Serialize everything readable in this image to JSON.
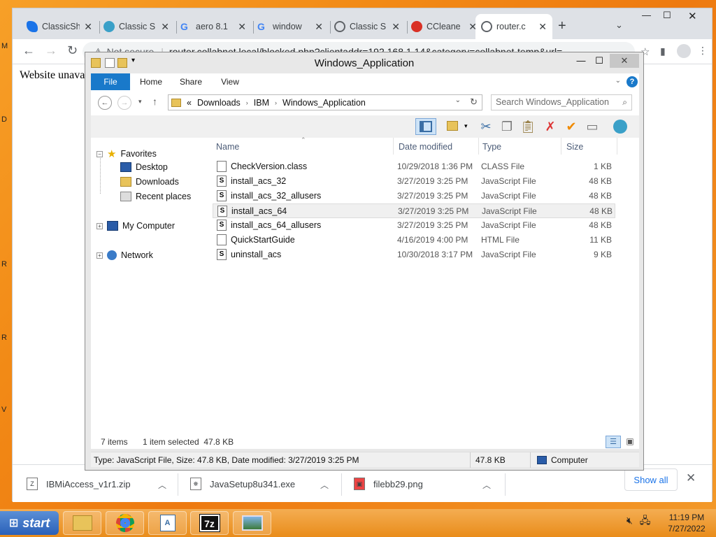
{
  "desktop": {
    "edge_letters": [
      "M",
      "D",
      "R",
      "R",
      "V"
    ]
  },
  "browser": {
    "tabs": [
      {
        "title": "ClassicSh",
        "icon": "classicshell-icon",
        "color": "#1a73e8"
      },
      {
        "title": "Classic S",
        "icon": "classic-shell-shell-icon",
        "color": "#3aa0c8"
      },
      {
        "title": "aero 8.1",
        "icon": "google-icon",
        "color": "#4285f4"
      },
      {
        "title": "window",
        "icon": "google-icon",
        "color": "#4285f4"
      },
      {
        "title": "Classic S",
        "icon": "globe-icon",
        "color": "#5f6368"
      },
      {
        "title": "CCleane",
        "icon": "ccleaner-icon",
        "color": "#d93025"
      },
      {
        "title": "router.c",
        "icon": "globe-icon",
        "color": "#5f6368",
        "active": true
      }
    ],
    "new_tab": "+",
    "omnibox": {
      "security": "Not secure",
      "url": "router.collabnet.local/blocked.php?clientaddr=192.168.1.14&category=collabnet-temp&url="
    },
    "page_text": "Website unavai",
    "downloads": [
      {
        "name": "IBMiAccess_v1r1.zip"
      },
      {
        "name": "JavaSetup8u341.exe"
      },
      {
        "name": "filebb29.png"
      }
    ],
    "show_all": "Show all"
  },
  "explorer": {
    "title": "Windows_Application",
    "ribbon_tabs": {
      "file": "File",
      "home": "Home",
      "share": "Share",
      "view": "View"
    },
    "address": {
      "chevrons": "«",
      "segments": [
        "Downloads",
        "IBM",
        "Windows_Application"
      ]
    },
    "search_placeholder": "Search Windows_Application",
    "nav": {
      "favorites": "Favorites",
      "desktop": "Desktop",
      "downloads": "Downloads",
      "recent": "Recent places",
      "computer": "My Computer",
      "network": "Network"
    },
    "columns": {
      "name": "Name",
      "date": "Date modified",
      "type": "Type",
      "size": "Size"
    },
    "files": [
      {
        "name": "CheckVersion.class",
        "date": "10/29/2018 1:36 PM",
        "type": "CLASS File",
        "size": "1 KB",
        "icon": "class-file-icon"
      },
      {
        "name": "install_acs_32",
        "date": "3/27/2019 3:25 PM",
        "type": "JavaScript File",
        "size": "48 KB",
        "icon": "script-file-icon"
      },
      {
        "name": "install_acs_32_allusers",
        "date": "3/27/2019 3:25 PM",
        "type": "JavaScript File",
        "size": "48 KB",
        "icon": "script-file-icon"
      },
      {
        "name": "install_acs_64",
        "date": "3/27/2019 3:25 PM",
        "type": "JavaScript File",
        "size": "48 KB",
        "icon": "script-file-icon",
        "selected": true
      },
      {
        "name": "install_acs_64_allusers",
        "date": "3/27/2019 3:25 PM",
        "type": "JavaScript File",
        "size": "48 KB",
        "icon": "script-file-icon"
      },
      {
        "name": "QuickStartGuide",
        "date": "4/16/2019 4:00 PM",
        "type": "HTML File",
        "size": "11 KB",
        "icon": "html-file-icon"
      },
      {
        "name": "uninstall_acs",
        "date": "10/30/2018 3:17 PM",
        "type": "JavaScript File",
        "size": "9 KB",
        "icon": "script-file-icon"
      }
    ],
    "status": {
      "items": "7 items",
      "selected": "1 item selected  47.8 KB"
    },
    "details": {
      "text": "Type: JavaScript File, Size: 47.8 KB, Date modified: 3/27/2019 3:25 PM",
      "size": "47.8 KB",
      "location": "Computer"
    }
  },
  "taskbar": {
    "start": "start",
    "apps": [
      "file-explorer-icon",
      "chrome-icon",
      "wordpad-icon",
      "7zip-icon",
      "image-viewer-icon"
    ],
    "seven_zip_label": "7z",
    "clock": {
      "time": "11:19 PM",
      "date": "7/27/2022"
    }
  }
}
